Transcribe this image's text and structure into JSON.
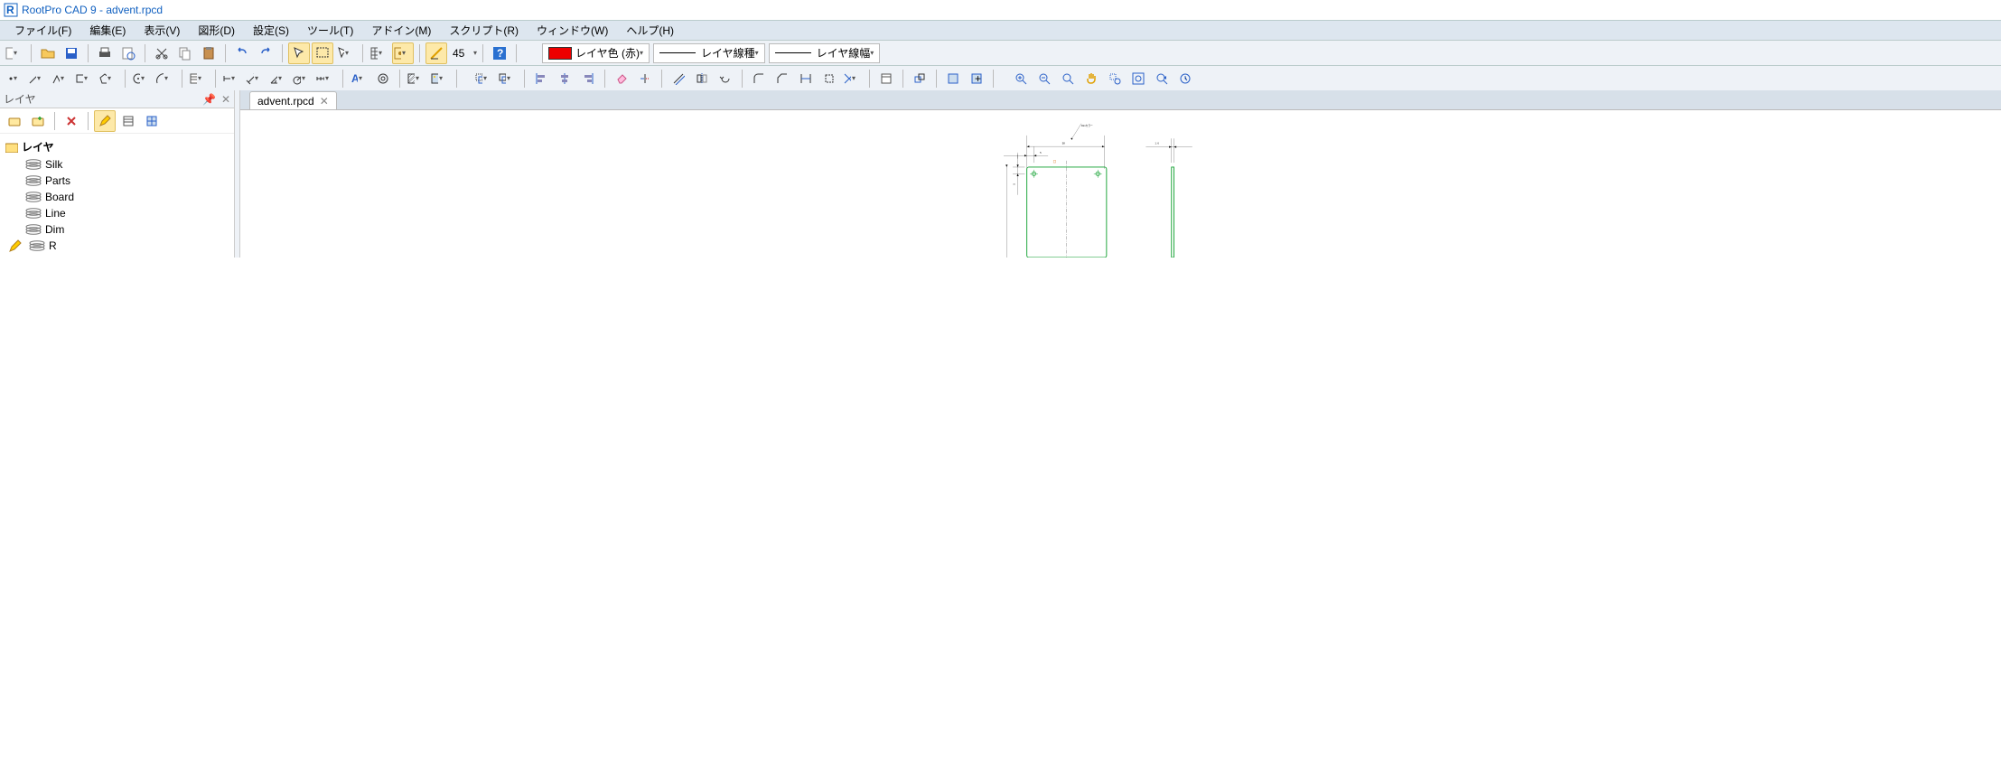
{
  "app": {
    "title": "RootPro CAD 9 - advent.rpcd"
  },
  "menu": {
    "file": "ファイル(F)",
    "edit": "編集(E)",
    "view": "表示(V)",
    "shape": "図形(D)",
    "settings": "設定(S)",
    "tool": "ツール(T)",
    "addin": "アドイン(M)",
    "script": "スクリプト(R)",
    "window": "ウィンドウ(W)",
    "help": "ヘルプ(H)"
  },
  "toolbar1": {
    "angle_value": "45",
    "layer_color_label": "レイヤ色 (赤)",
    "layer_linetype_label": "レイヤ線種",
    "layer_linewidth_label": "レイヤ線幅"
  },
  "sidepanel": {
    "title": "レイヤ",
    "root": "レイヤ",
    "items": [
      {
        "name": "Silk",
        "current": false
      },
      {
        "name": "Parts",
        "current": false
      },
      {
        "name": "Board",
        "current": false
      },
      {
        "name": "Line",
        "current": false
      },
      {
        "name": "Dim",
        "current": false
      },
      {
        "name": "R",
        "current": true
      }
    ]
  },
  "document_tab": {
    "name": "advent.rpcd"
  },
  "drawing": {
    "annotation": "Dimカラー",
    "dim_58": "58",
    "dim_5h": "5",
    "dim_5v": "5",
    "dim_1_6": "1. 6"
  }
}
